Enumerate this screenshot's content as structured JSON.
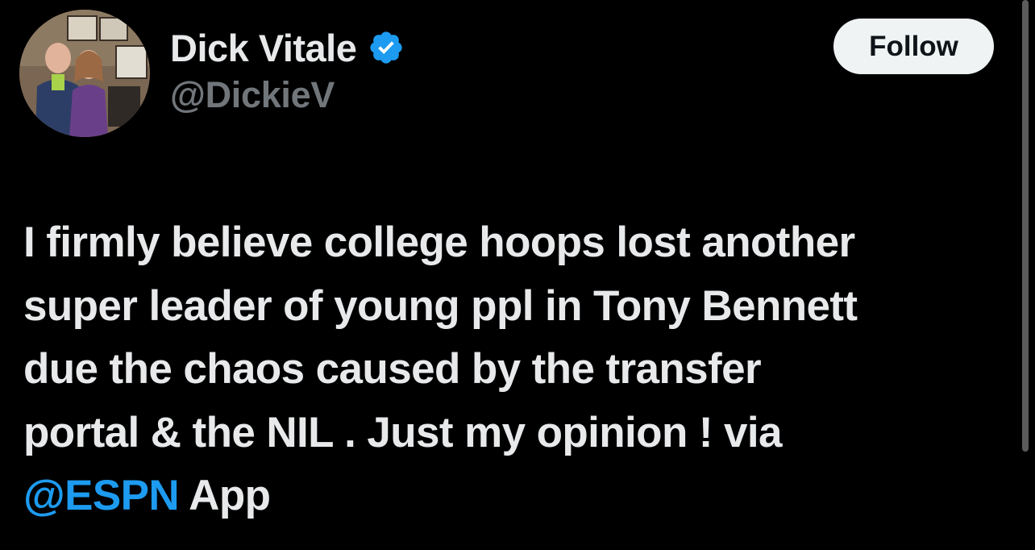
{
  "author": {
    "display_name": "Dick Vitale",
    "handle": "@DickieV",
    "verified": true,
    "verified_color": "#1d9bf0",
    "avatar_icon": "profile-photo"
  },
  "follow_label": "Follow",
  "tweet": {
    "lines": [
      "I firmly believe college hoops lost another",
      "super leader of young ppl in Tony Bennett",
      "due the chaos caused by the transfer",
      "portal & the NIL . Just my opinion ! via"
    ],
    "mention": "@ESPN",
    "after_mention": " App"
  },
  "colors": {
    "background": "#000000",
    "text": "#e7e9ea",
    "secondary": "#71767b",
    "accent": "#1d9bf0"
  }
}
